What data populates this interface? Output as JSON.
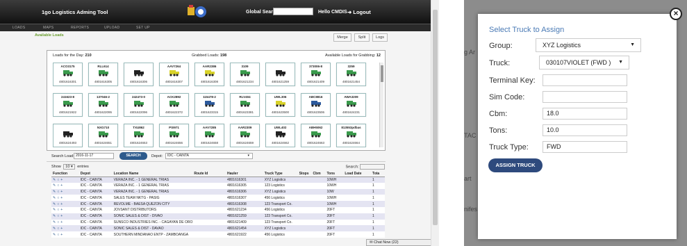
{
  "app": {
    "title": "1go Logistics Adming Tool",
    "global_search_label": "Global Search",
    "greeting": "Hello CMDIS",
    "logout_label": "Logout"
  },
  "menu": [
    "LOADS",
    "MAPS",
    "REPORTS",
    "UPLOAD",
    "SET UP"
  ],
  "section_title": "Available Loads",
  "toolbar": {
    "merge": "Merge",
    "split": "Split",
    "logs": "Logs"
  },
  "loads_panel": {
    "loads_for_day_label": "Loads for the Day:",
    "loads_for_day": "210",
    "grabbed_label": "Grabbed Loads:",
    "grabbed": "198",
    "available_label": "Available Loads for Grabbing:",
    "available": "12"
  },
  "cards": [
    {
      "id": "ACO3175",
      "num": "4801616301",
      "color": "#3a9a4c"
    },
    {
      "id": "RLL614",
      "num": "4801616305",
      "color": "#3a9a4c"
    },
    {
      "id": "",
      "num": "4801616306",
      "color": "#222222"
    },
    {
      "id": "AAV7264",
      "num": "4801616307",
      "color": "#d8d22a"
    },
    {
      "id": "AAR2386",
      "num": "4801616308",
      "color": "#d8d22a"
    },
    {
      "id": "3109",
      "num": "4801621234",
      "color": "#3a9a4c"
    },
    {
      "id": "",
      "num": "4801621259",
      "color": "#222222"
    },
    {
      "id": "373006-8",
      "num": "4801621409",
      "color": "#3a9a4c"
    },
    {
      "id": "3259",
      "num": "4801621454",
      "color": "#3a9a4c"
    },
    {
      "id": "241623-8",
      "num": "4801621922",
      "color": "#3a9a4c"
    },
    {
      "id": "137046-2",
      "num": "4801622095",
      "color": "#3a9a4c"
    },
    {
      "id": "242473-0",
      "num": "4801622096",
      "color": "#3a9a4c"
    },
    {
      "id": "ACK2892",
      "num": "4801622372",
      "color": "#3a9a4c"
    },
    {
      "id": "115478-2",
      "num": "4801623315",
      "color": "#2d5a9c"
    },
    {
      "id": "RLV404",
      "num": "4801623381",
      "color": "#3a9a4c"
    },
    {
      "id": "UWL306",
      "num": "4801623500",
      "color": "#d8d22a"
    },
    {
      "id": "ABC8816",
      "num": "4801623506",
      "color": "#2d5a9c"
    },
    {
      "id": "AWA3209",
      "num": "4801624231",
      "color": "#3a9a4c"
    },
    {
      "id": "",
      "num": "4801624493",
      "color": "#222222"
    },
    {
      "id": "NXG710",
      "num": "4801624651",
      "color": "#3a9a4c"
    },
    {
      "id": "TXU862",
      "num": "4801624653",
      "color": "#3a9a4c"
    },
    {
      "id": "PSI971",
      "num": "4801624656",
      "color": "#3a9a4c"
    },
    {
      "id": "AAV7285",
      "num": "4801624658",
      "color": "#3a9a4c"
    },
    {
      "id": "AAR2309",
      "num": "4801624659",
      "color": "#3a9a4c"
    },
    {
      "id": "UWL402",
      "num": "4801624662",
      "color": "#222222"
    },
    {
      "id": "ABH5062",
      "num": "4801624663",
      "color": "#3a9a4c"
    },
    {
      "id": "813553pdbas",
      "num": "4801624664",
      "color": "#3a9a4c"
    }
  ],
  "search_bar": {
    "search_load_label": "Search Load:",
    "date_value": "2016-11-17",
    "search_button": "SEARCH",
    "depot_label": "Depot:",
    "depot_value": "IDC - CAINTA"
  },
  "datatable": {
    "show_label": "Show",
    "show_value": "10",
    "entries_label": "entries",
    "search_label": "Search:",
    "columns": [
      "Function",
      "Depot",
      "Location Name",
      "Route Id",
      "Hauler",
      "Truck Type",
      "Stops",
      "Cbm",
      "Tons",
      "Load Date",
      "Tota"
    ],
    "rows": [
      [
        "IDC - CAINTA",
        "VERAZA INC. - 1 GENERAL TRIAS",
        "",
        "4801616301",
        "XYZ Logistics",
        "10WH",
        "1"
      ],
      [
        "IDC - CAINTA",
        "VERAZA INC. - 1 GENERAL TRIAS",
        "",
        "4801616305",
        "123 Logistics",
        "10WH",
        "1"
      ],
      [
        "IDC - CAINTA",
        "VERAZA INC. - 1 GENERAL TRIAS",
        "",
        "4801616306",
        "XYZ Logistics",
        "10W",
        "1"
      ],
      [
        "IDC - CAINTA",
        "SALES TEAM NKTG - PASIG",
        "",
        "4801616307",
        "456 Logistics",
        "10WH",
        "1"
      ],
      [
        "IDC - CAINTA",
        "REVOLME - BAESA QUEZON CITY",
        "",
        "4801616308",
        "123 Transport Co.",
        "10WH",
        "1"
      ],
      [
        "IDC - CAINTA",
        "JOVSANT DISTRIBUTORS",
        "",
        "4801621234",
        "456 Logistics",
        "20FT",
        "1"
      ],
      [
        "IDC - CAINTA",
        "SONIC SALES & DIST - DIVAO",
        "",
        "4801621259",
        "123 Transport Co.",
        "20FT",
        "1"
      ],
      [
        "IDC - CAINTA",
        "SUNSCO INDUSTRIES INC. - CAGAYAN DE ORO",
        "",
        "4801621409",
        "123 Transport Co.",
        "20FT",
        "1"
      ],
      [
        "IDC - CAINTA",
        "SONIC SALES & DIST - DAVAO",
        "",
        "4801621454",
        "XYZ Logistics",
        "20FT",
        "1"
      ],
      [
        "IDC - CAINTA",
        "SOUTHERN MINDANAO ENTP - ZAMBOANGA",
        "",
        "4801621922",
        "456 Logistics",
        "20FT",
        "1"
      ]
    ]
  },
  "chat_label": "Chat Now (22)",
  "background_ghost": [
    "g Ar",
    "TAC",
    "art",
    "nifes"
  ],
  "modal": {
    "title": "Select Truck to Assign",
    "group_label": "Group:",
    "group_value": "XYZ Logistics",
    "truck_label": "Truck:",
    "truck_value": "030107VIOLET (FWD )",
    "terminal_label": "Terminal Key:",
    "terminal_value": "",
    "sim_label": "Sim Code:",
    "sim_value": "",
    "cbm_label": "Cbm:",
    "cbm_value": "18.0",
    "tons_label": "Tons:",
    "tons_value": "10.0",
    "truck_type_label": "Truck Type:",
    "truck_type_value": "FWD",
    "assign_button": "ASSIGN TRUCK"
  }
}
